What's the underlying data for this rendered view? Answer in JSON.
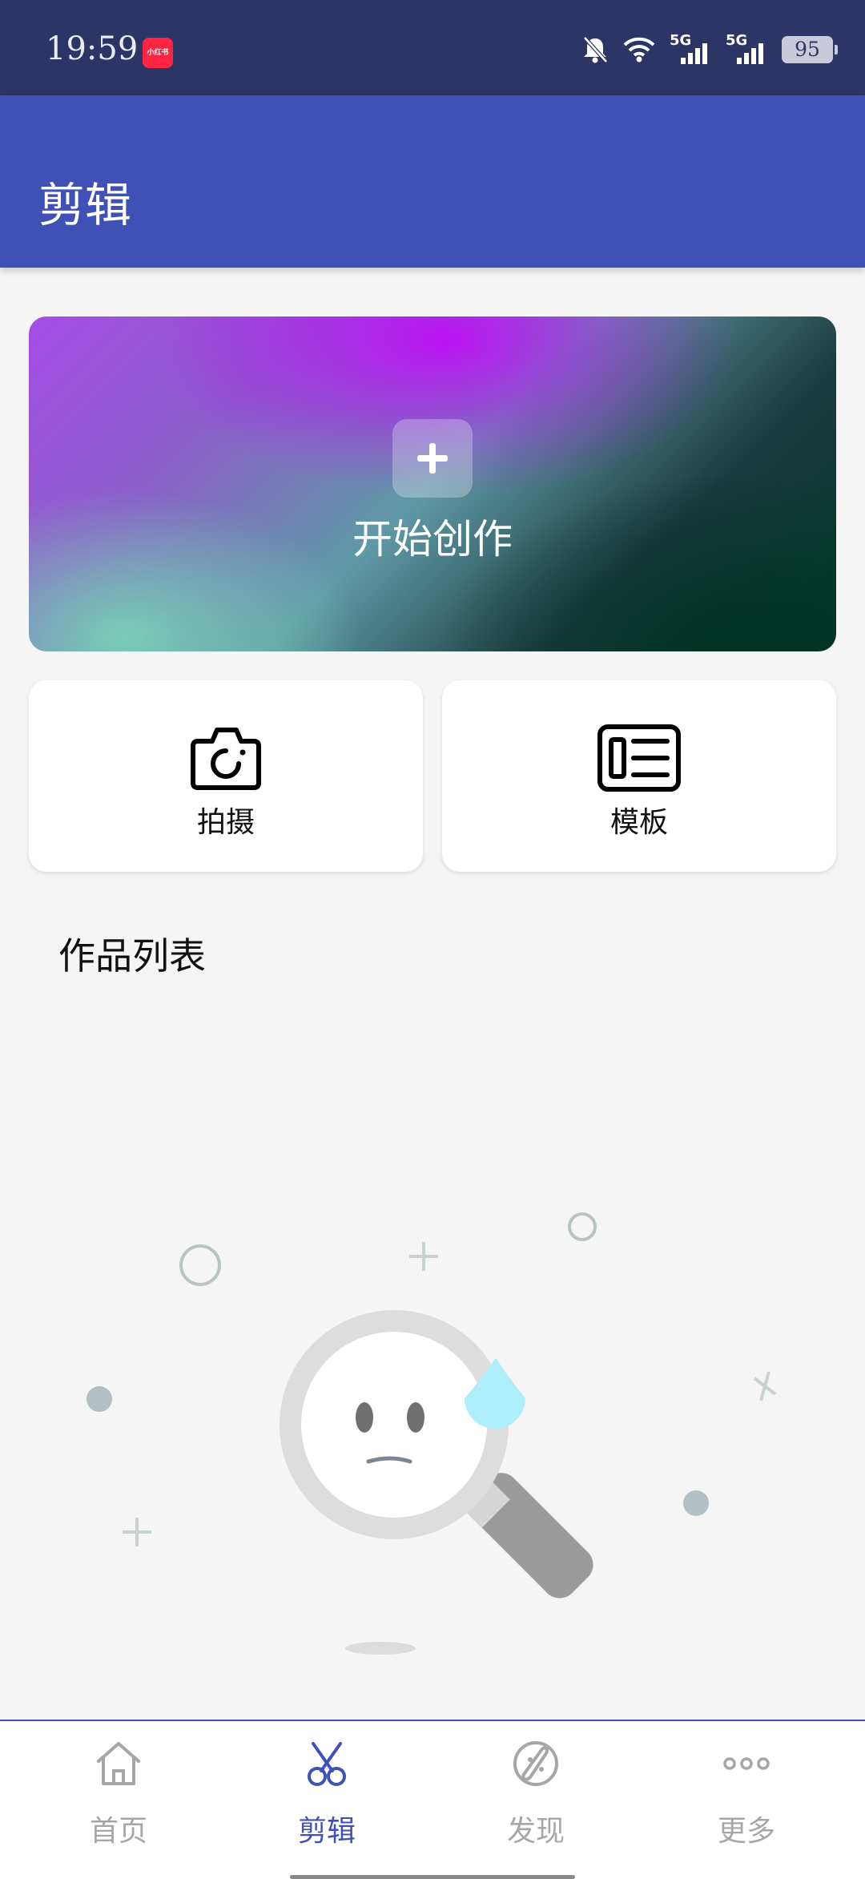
{
  "status_bar": {
    "time": "19:59",
    "app_badge": "小红书",
    "network_1": "5G",
    "network_2": "5G",
    "battery": "95",
    "icons": [
      "bell-off-icon",
      "wifi-icon",
      "signal-icon",
      "signal-icon",
      "battery-icon"
    ]
  },
  "app_bar": {
    "title": "剪辑",
    "color": "#3f51b5"
  },
  "hero": {
    "label": "开始创作",
    "icon": "plus-icon"
  },
  "actions": [
    {
      "label": "拍摄",
      "icon": "camera-icon"
    },
    {
      "label": "模板",
      "icon": "template-icon"
    }
  ],
  "works": {
    "title": "作品列表",
    "empty_icon": "empty-search-icon"
  },
  "bottom_nav": {
    "active_color": "#3f51b5",
    "items": [
      {
        "label": "首页",
        "icon": "home-icon",
        "active": false
      },
      {
        "label": "剪辑",
        "icon": "scissors-icon",
        "active": true
      },
      {
        "label": "发现",
        "icon": "discover-icon",
        "active": false
      },
      {
        "label": "更多",
        "icon": "more-icon",
        "active": false
      }
    ]
  }
}
